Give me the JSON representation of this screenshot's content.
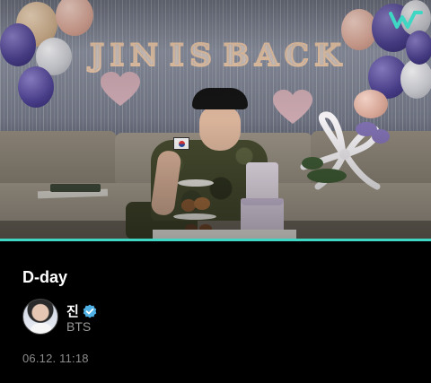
{
  "photo": {
    "banner_letters": [
      "J",
      "I",
      "N",
      " ",
      "I",
      "S",
      " ",
      "B",
      "A",
      "C",
      "K"
    ],
    "logo_icon": "weverse-logo-icon"
  },
  "media": {
    "progress": 1.0,
    "accent_color": "#3fd6c3"
  },
  "post": {
    "title": "D-day",
    "author": {
      "name": "진",
      "verified_icon": "verified-badge-icon",
      "group": "BTS",
      "avatar_icon": "avatar"
    },
    "timestamp": "06.12. 11:18"
  },
  "colors": {
    "background": "#000000",
    "secondary_text": "#9a9a9a",
    "verified": "#4fb0e6"
  }
}
